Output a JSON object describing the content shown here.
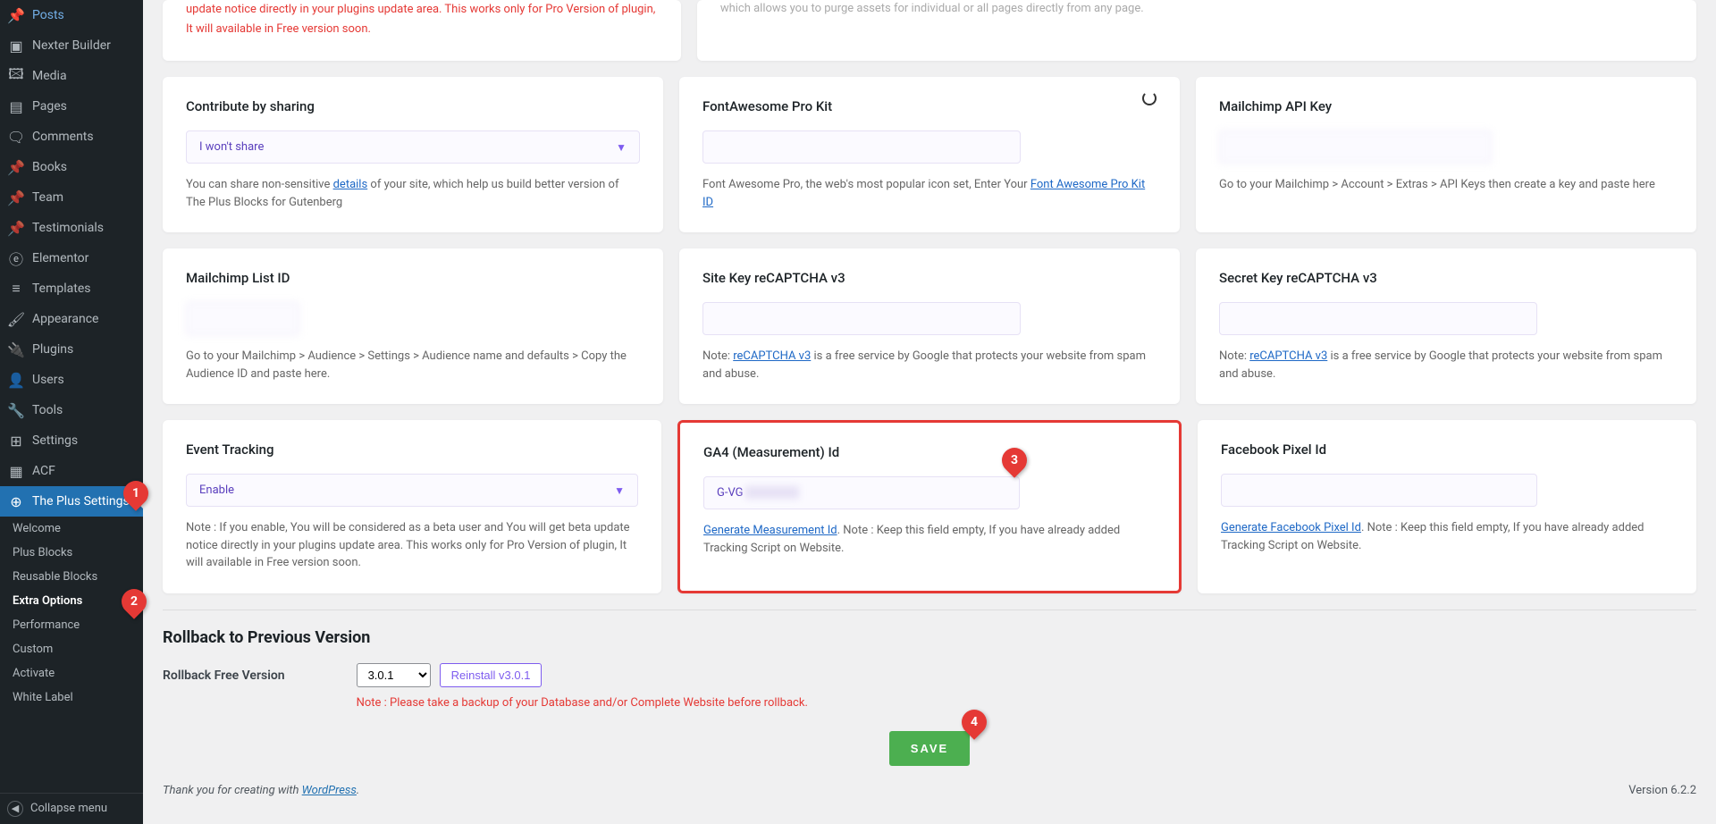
{
  "sidebar": {
    "items": [
      {
        "icon": "📌",
        "label": "Posts"
      },
      {
        "icon": "▣",
        "label": "Nexter Builder"
      },
      {
        "icon": "🖾",
        "label": "Media"
      },
      {
        "icon": "▤",
        "label": "Pages"
      },
      {
        "icon": "🗨",
        "label": "Comments"
      },
      {
        "icon": "📌",
        "label": "Books"
      },
      {
        "icon": "📌",
        "label": "Team"
      },
      {
        "icon": "📌",
        "label": "Testimonials"
      },
      {
        "icon": "ⓔ",
        "label": "Elementor"
      },
      {
        "icon": "≡",
        "label": "Templates"
      },
      {
        "icon": "🖌",
        "label": "Appearance"
      },
      {
        "icon": "🔌",
        "label": "Plugins"
      },
      {
        "icon": "👤",
        "label": "Users"
      },
      {
        "icon": "🔧",
        "label": "Tools"
      },
      {
        "icon": "⊞",
        "label": "Settings"
      },
      {
        "icon": "▦",
        "label": "ACF"
      },
      {
        "icon": "⊕",
        "label": "The Plus Settings"
      }
    ],
    "submenu": [
      {
        "label": "Welcome"
      },
      {
        "label": "Plus Blocks"
      },
      {
        "label": "Reusable Blocks"
      },
      {
        "label": "Extra Options"
      },
      {
        "label": "Performance"
      },
      {
        "label": "Custom"
      },
      {
        "label": "Activate"
      },
      {
        "label": "White Label"
      }
    ],
    "collapse": "Collapse menu"
  },
  "top_partial": {
    "left": "update notice directly in your plugins update area. This works only for Pro Version of plugin, It will available in Free version soon.",
    "right": "which allows you to purge assets for individual or all pages directly from any page."
  },
  "row1": {
    "contribute": {
      "title": "Contribute by sharing",
      "select": "I won't share",
      "help_pre": "You can share non-sensitive ",
      "help_link": "details",
      "help_post": " of your site, which help us build better version of The Plus Blocks for Gutenberg"
    },
    "fontawesome": {
      "title": "FontAwesome Pro Kit",
      "help_pre": "Font Awesome Pro, the web's most popular icon set, Enter Your ",
      "help_link": "Font Awesome Pro Kit ID"
    },
    "mailchimp_key": {
      "title": "Mailchimp API Key",
      "help": "Go to your Mailchimp > Account > Extras > API Keys then create a key and paste here"
    }
  },
  "row2": {
    "mailchimp_list": {
      "title": "Mailchimp List ID",
      "help": "Go to your Mailchimp > Audience > Settings > Audience name and defaults > Copy the Audience ID and paste here."
    },
    "recaptcha_site": {
      "title": "Site Key reCAPTCHA v3",
      "help_pre": "Note: ",
      "help_link": "reCAPTCHA v3",
      "help_post": " is a free service by Google that protects your website from spam and abuse."
    },
    "recaptcha_secret": {
      "title": "Secret Key reCAPTCHA v3",
      "help_pre": "Note: ",
      "help_link": "reCAPTCHA v3",
      "help_post": " is a free service by Google that protects your website from spam and abuse."
    }
  },
  "row3": {
    "event_tracking": {
      "title": "Event Tracking",
      "select": "Enable",
      "help": "Note : If you enable, You will be considered as a beta user and You will get beta update notice directly in your plugins update area. This works only for Pro Version of plugin, It will available in Free version soon."
    },
    "ga4": {
      "title": "GA4 (Measurement) Id",
      "value": "G-VG",
      "help_link": "Generate Measurement Id",
      "help_post": ". Note : Keep this field empty, If you have already added Tracking Script on Website."
    },
    "fbpixel": {
      "title": "Facebook Pixel Id",
      "help_link": "Generate Facebook Pixel Id",
      "help_post": ". Note : Keep this field empty, If you have already added Tracking Script on Website."
    }
  },
  "rollback": {
    "title": "Rollback to Previous Version",
    "label": "Rollback Free Version",
    "version": "3.0.1",
    "reinstall": "Reinstall v3.0.1",
    "note": "Note : Please take a backup of your Database and/or Complete Website before rollback."
  },
  "save": "SAVE",
  "footer": {
    "thank_pre": "Thank you for creating with ",
    "thank_link": "WordPress",
    "version": "Version 6.2.2"
  },
  "markers": {
    "m1": "1",
    "m2": "2",
    "m3": "3",
    "m4": "4"
  }
}
